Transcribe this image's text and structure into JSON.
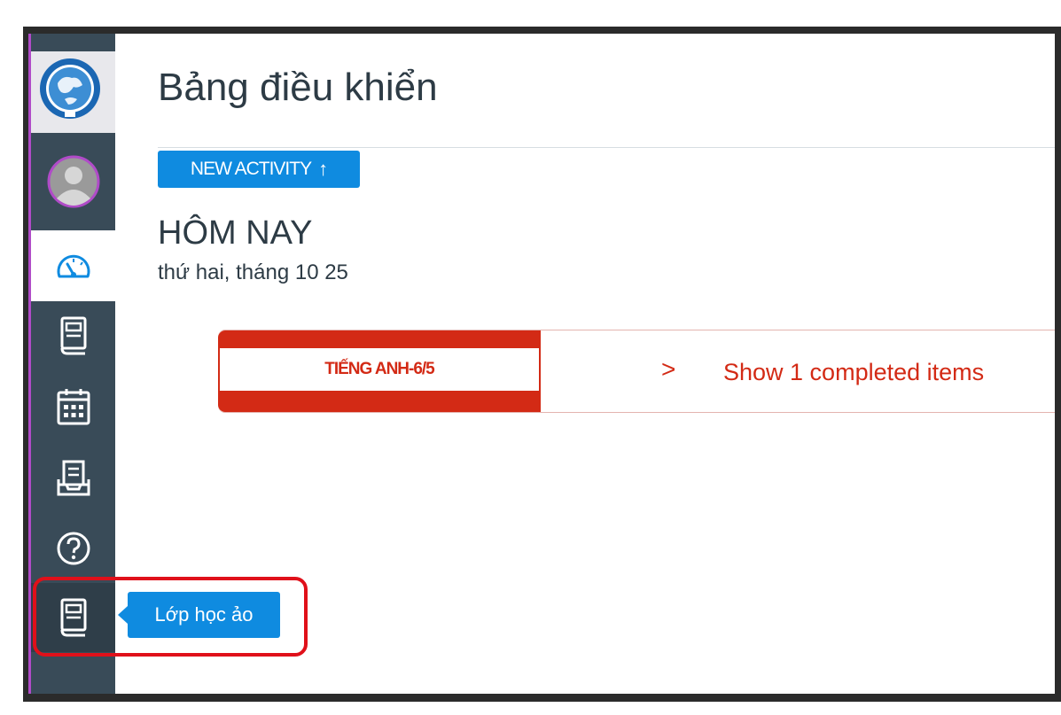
{
  "page": {
    "title": "Bảng điều khiển"
  },
  "toolbar": {
    "new_activity_label": "NEW ACTIVITY",
    "new_activity_icon": "arrow-up-icon"
  },
  "today": {
    "heading": "HÔM NAY",
    "date": "thứ hai, tháng 10 25"
  },
  "course_card": {
    "course_name": "TIẾNG ANH-6/5",
    "show_completed_label": "Show 1 completed items",
    "chevron": ">"
  },
  "sidebar": {
    "items": [
      {
        "name": "account",
        "icon": "avatar-icon"
      },
      {
        "name": "dashboard",
        "icon": "dashboard-gauge-icon",
        "active": true
      },
      {
        "name": "courses",
        "icon": "book-icon"
      },
      {
        "name": "calendar",
        "icon": "calendar-icon"
      },
      {
        "name": "inbox",
        "icon": "inbox-tray-icon"
      },
      {
        "name": "help",
        "icon": "help-circle-icon"
      },
      {
        "name": "virtual-classroom",
        "icon": "book-icon"
      }
    ]
  },
  "tooltip": {
    "label": "Lớp học ảo"
  },
  "colors": {
    "sidebar_bg": "#394b58",
    "accent_blue": "#0f8be0",
    "course_red": "#d32a15",
    "highlight_red": "#e0101a",
    "text_dark": "#2d3b45"
  }
}
